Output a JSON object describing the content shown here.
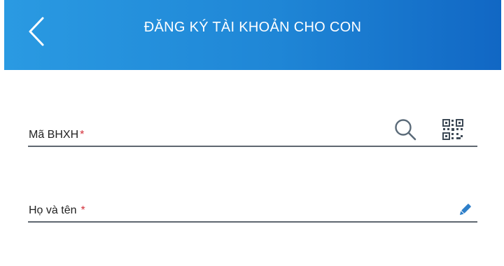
{
  "header": {
    "title": "ĐĂNG KÝ TÀI KHOẢN CHO CON",
    "back_icon": "chevron-left-icon",
    "background": "#1f86d6"
  },
  "form": {
    "fields": [
      {
        "label": "Mã BHXH",
        "required_mark": "*",
        "icons": [
          "search-icon",
          "qr-code-icon"
        ]
      },
      {
        "label": "Họ và tên",
        "required_mark": "*",
        "icons": [
          "edit-icon"
        ]
      }
    ],
    "required_color": "#d3303a",
    "underline_color": "#5f6770"
  }
}
